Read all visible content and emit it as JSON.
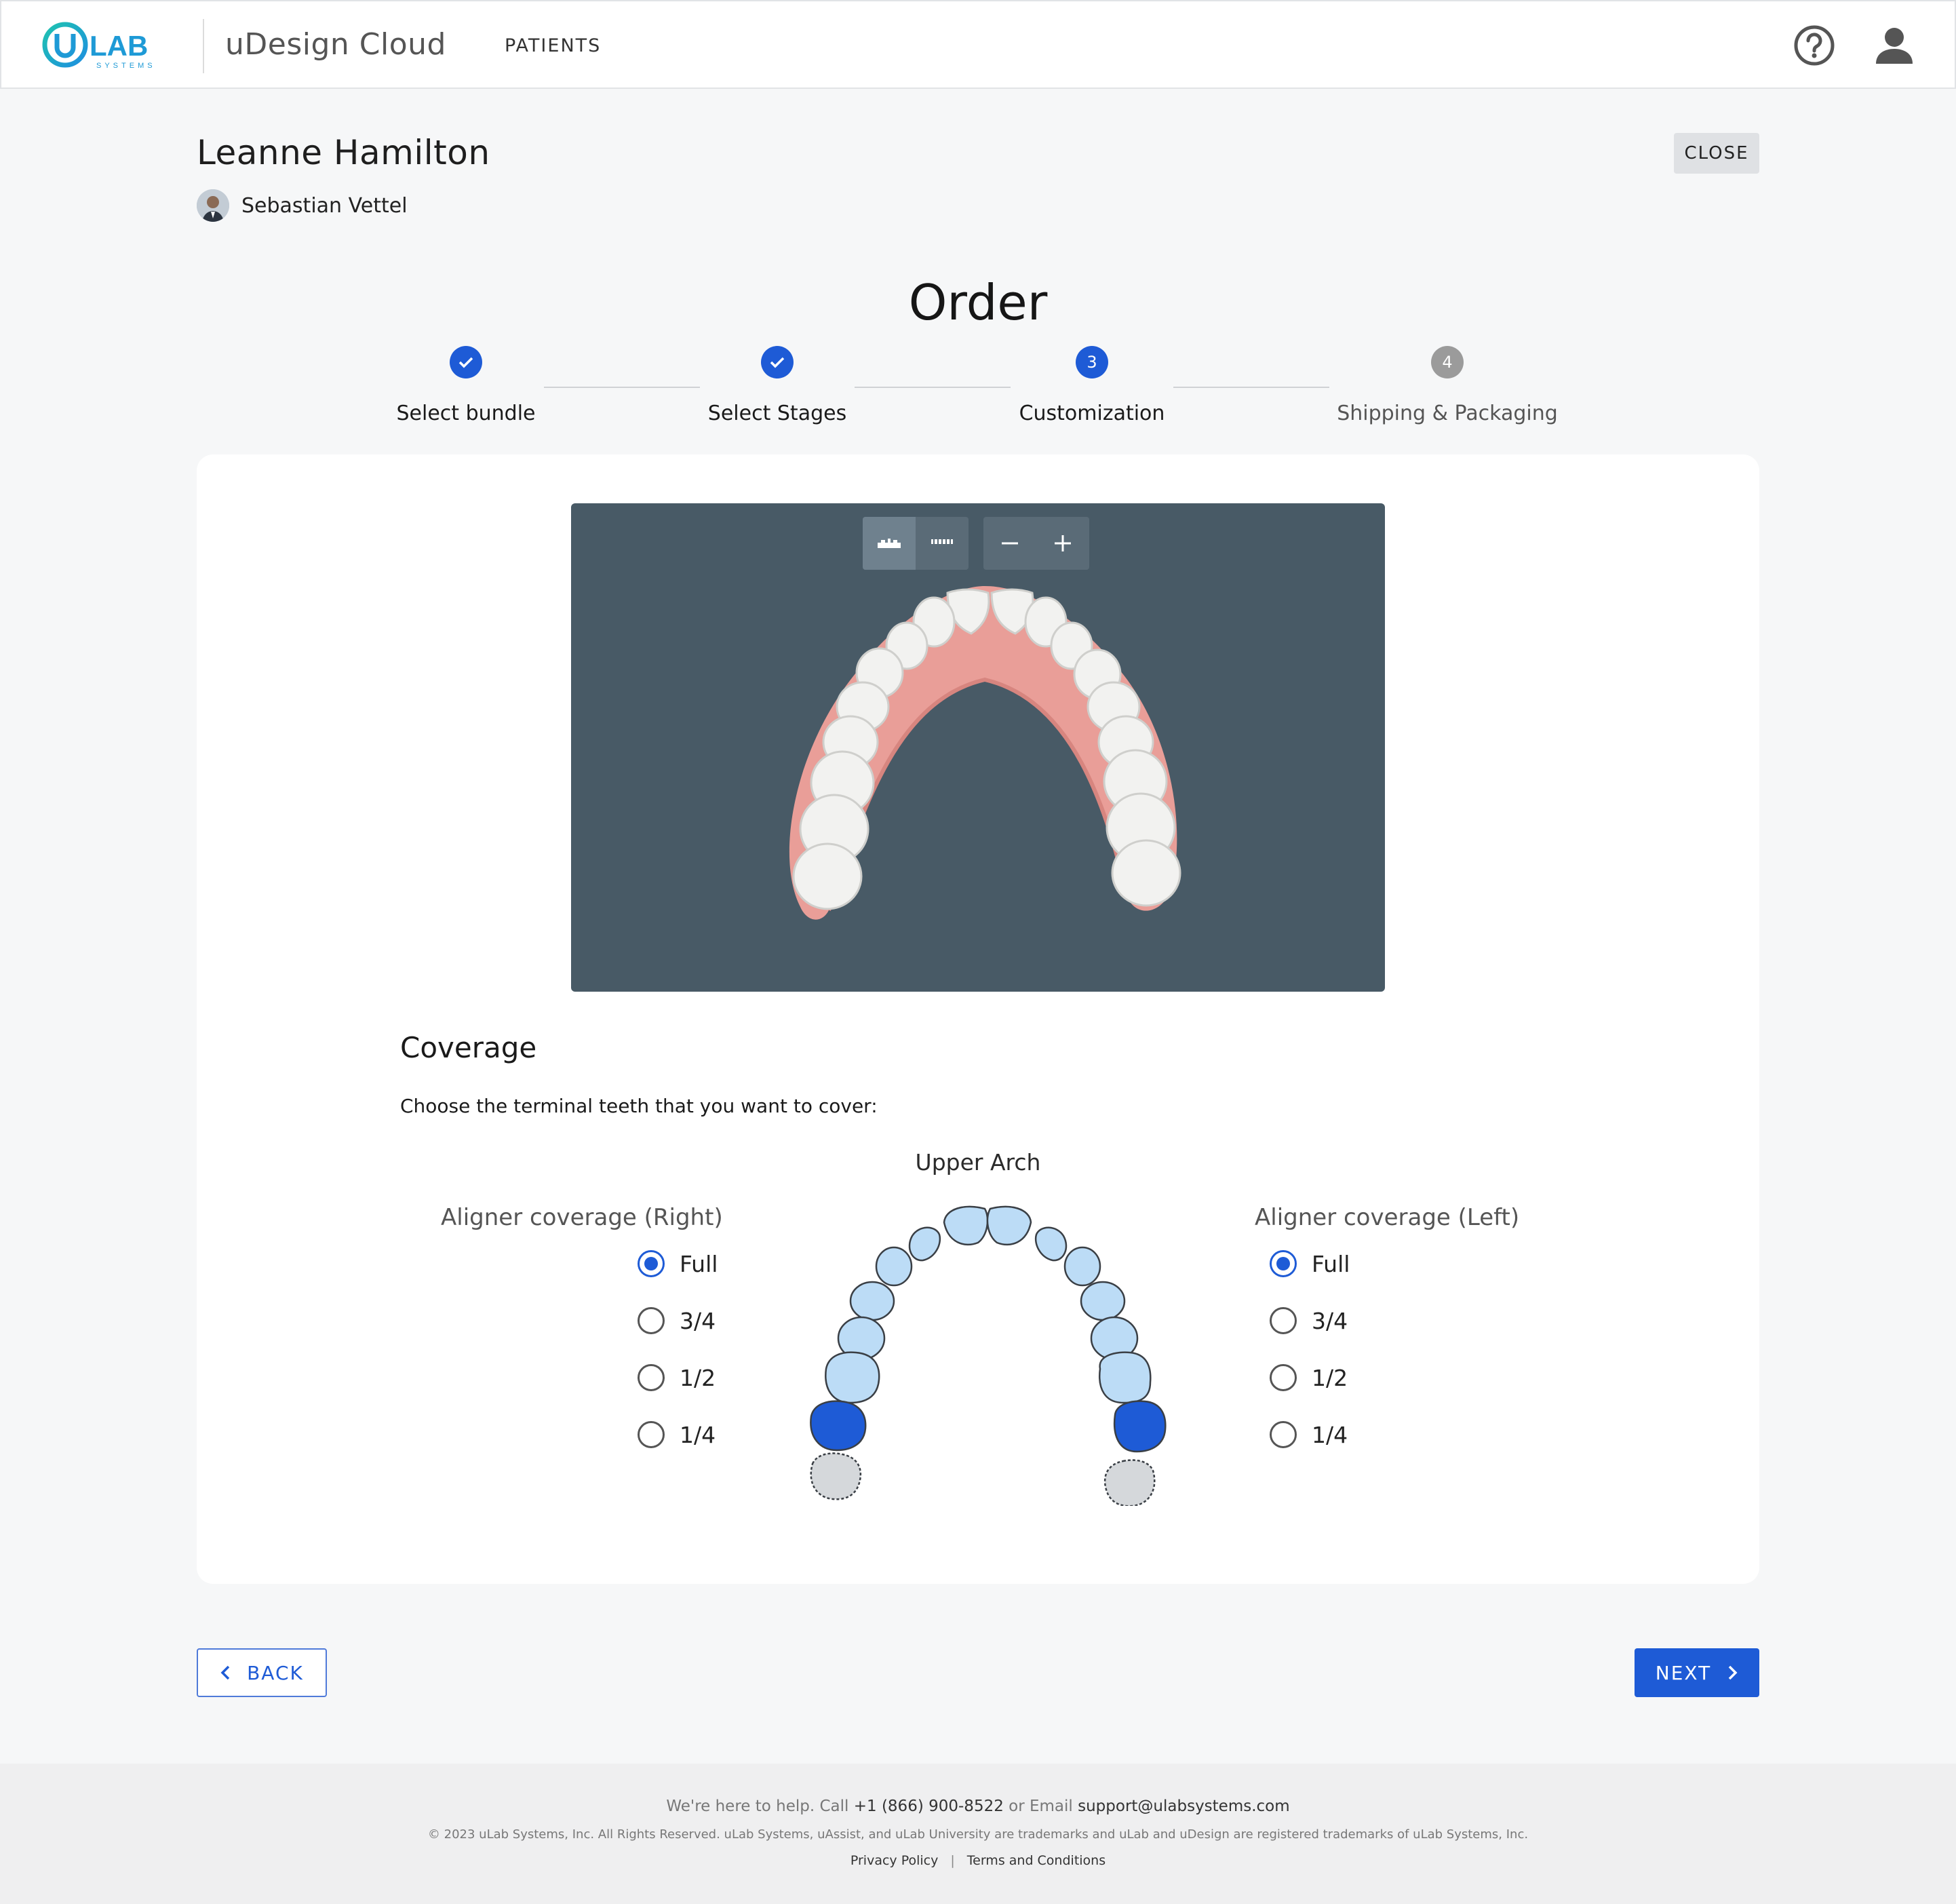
{
  "header": {
    "logo_text": "LAB",
    "logo_sub": "SYSTEMS",
    "app_title": "uDesign Cloud",
    "nav_patients": "PATIENTS"
  },
  "patient": {
    "name": "Leanne Hamilton",
    "doctor": "Sebastian Vettel",
    "close_label": "CLOSE"
  },
  "order": {
    "title": "Order",
    "steps": [
      {
        "label": "Select bundle",
        "state": "done",
        "number": ""
      },
      {
        "label": "Select Stages",
        "state": "done",
        "number": ""
      },
      {
        "label": "Customization",
        "state": "active",
        "number": "3"
      },
      {
        "label": "Shipping & Packaging",
        "state": "pending",
        "number": "4"
      }
    ]
  },
  "viewer": {
    "tools": [
      "upper-arch-icon",
      "lower-arch-icon",
      "zoom-out-icon",
      "zoom-in-icon"
    ]
  },
  "coverage": {
    "title": "Coverage",
    "instruction": "Choose the terminal teeth that you want to cover:",
    "arch_label": "Upper Arch",
    "right": {
      "heading": "Aligner coverage  (Right)",
      "options": [
        "Full",
        "3/4",
        "1/2",
        "1/4"
      ],
      "selected": "Full"
    },
    "left": {
      "heading": "Aligner coverage  (Left)",
      "options": [
        "Full",
        "3/4",
        "1/2",
        "1/4"
      ],
      "selected": "Full"
    },
    "colors": {
      "covered": "#bcdcf6",
      "terminal": "#1e5bd6",
      "uncovered": "#d5d8db"
    }
  },
  "nav": {
    "back_label": "BACK",
    "next_label": "NEXT"
  },
  "footer": {
    "help_prefix": "We're here to help. Call ",
    "phone": "+1 (866) 900-8522",
    "help_mid": " or Email ",
    "email": "support@ulabsystems.com",
    "copyright": "© 2023 uLab Systems, Inc. All Rights Reserved. uLab Systems, uAssist, and uLab University are trademarks and uLab and uDesign are registered trademarks of uLab Systems, Inc.",
    "privacy": "Privacy Policy",
    "terms": "Terms and Conditions"
  },
  "theme": {
    "accent": "#1e5bd6",
    "viewer_bg": "#485a66"
  }
}
